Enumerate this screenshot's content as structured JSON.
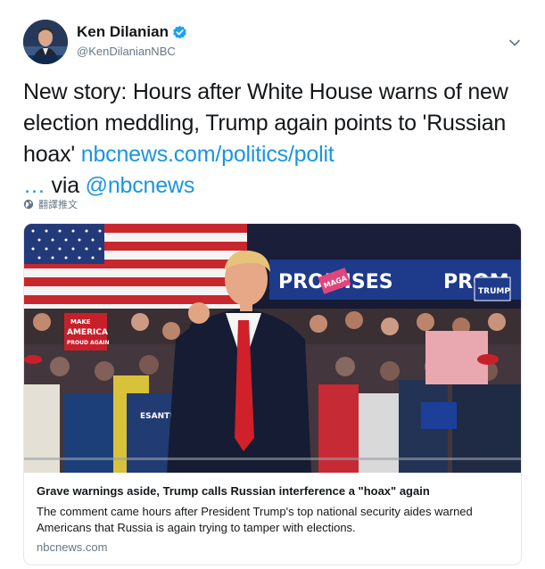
{
  "author": {
    "display_name": "Ken Dilanian",
    "handle": "@KenDilanianNBC"
  },
  "tweet": {
    "text_main": "New story: Hours after White House warns of new election meddling, Trump again points to 'Russian hoax' ",
    "link_text": "nbcnews.com/politics/polit",
    "ellipsis": " … via ",
    "mention": "@nbcnews"
  },
  "translate": {
    "label": "翻譯推文"
  },
  "card": {
    "title": "Grave warnings aside, Trump calls Russian interference a \"hoax\" again",
    "description": "The comment came hours after President Trump's top national security aides warned Americans that Russia is again trying to tamper with elections.",
    "domain": "nbcnews.com",
    "image_signs": {
      "left_sign_line1": "MAKE",
      "left_sign_line2": "AMERICA",
      "left_sign_line3": "PROUD AGAIN",
      "banner_left": "PROMISES",
      "banner_right": "PROM",
      "small_sign": "TRUMP",
      "shirt_text": "ESANTIS",
      "pink_sign": "MAGA"
    }
  },
  "colors": {
    "link": "#1b95e0",
    "verified": "#1da1f2",
    "muted": "#657786",
    "text": "#14171a",
    "border": "#e1e8ed"
  },
  "icons": {
    "verified": "verified-badge-icon",
    "chevron": "chevron-down-icon",
    "globe": "globe-icon"
  }
}
